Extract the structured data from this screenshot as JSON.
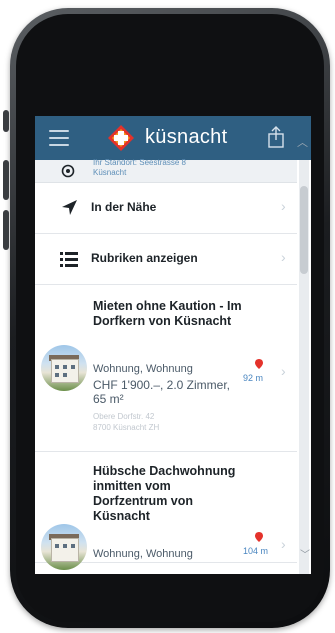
{
  "app": {
    "brand": "küsnacht",
    "accent_color": "#2f5f82",
    "logo_color": "#e4322b"
  },
  "partial_row": {
    "line1": "Ihr Standort: Seestrasse 8",
    "line2": "Küsnacht"
  },
  "menu": [
    {
      "label": "In der Nähe",
      "icon": "navigation-arrow-icon"
    },
    {
      "label": "Rubriken anzeigen",
      "icon": "list-icon"
    }
  ],
  "listings": [
    {
      "title": "Mieten ohne Kaution - Im Dorfkern von Küsnacht",
      "type": "Wohnung, Wohnung",
      "price": "CHF 1'900.–, 2.0 Zimmer, 65 m²",
      "addr1": "Obere Dorfstr. 42",
      "addr2": "8700 Küsnacht ZH",
      "distance": "92 m"
    },
    {
      "title": "Hübsche Dachwohnung inmitten vom Dorfzentrum von Küsnacht",
      "type": "Wohnung, Wohnung",
      "distance": "104 m"
    }
  ]
}
